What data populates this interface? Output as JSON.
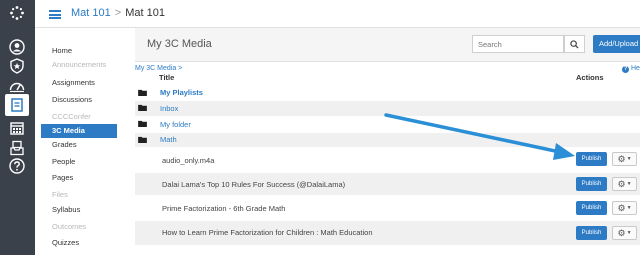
{
  "global_nav": {
    "icons": [
      "canvas-logo-icon",
      "account-icon",
      "admin-icon",
      "dashboard-icon",
      "courses-icon",
      "calendar-icon",
      "inbox-icon",
      "help-icon"
    ]
  },
  "breadcrumb": {
    "course": "Mat 101",
    "separator": ">",
    "current": "Mat 101"
  },
  "course_nav": [
    {
      "label": "Home",
      "state": "normal"
    },
    {
      "label": "Announcements",
      "state": "dim"
    },
    {
      "label": "Assignments",
      "state": "normal"
    },
    {
      "label": "Discussions",
      "state": "normal"
    },
    {
      "label": "CCCConfer",
      "state": "dim"
    },
    {
      "label": "3C Media",
      "state": "active"
    },
    {
      "label": "Grades",
      "state": "normal"
    },
    {
      "label": "People",
      "state": "normal"
    },
    {
      "label": "Pages",
      "state": "normal"
    },
    {
      "label": "Files",
      "state": "dim"
    },
    {
      "label": "Syllabus",
      "state": "normal"
    },
    {
      "label": "Outcomes",
      "state": "dim"
    },
    {
      "label": "Quizzes",
      "state": "normal"
    }
  ],
  "header": {
    "title": "My 3C Media",
    "search_placeholder": "Search",
    "add_upload_label": "Add/Upload ▾"
  },
  "path": "My 3C Media >",
  "help_label": "He",
  "table": {
    "title_header": "Title",
    "actions_header": "Actions"
  },
  "folders": [
    {
      "label": "My Playlists",
      "style": "bold"
    },
    {
      "label": "Inbox",
      "style": "link"
    },
    {
      "label": "My folder",
      "style": "link"
    },
    {
      "label": "Math",
      "style": "link"
    }
  ],
  "files": [
    {
      "title": "audio_only.m4a",
      "publish_label": "Publish"
    },
    {
      "title": "Dalai Lama's Top 10 Rules For Success (@DalaiLama)",
      "publish_label": "Publish"
    },
    {
      "title": "Prime Factorization - 6th Grade Math",
      "publish_label": "Publish"
    },
    {
      "title": "How to Learn Prime Factorization for Children : Math Education",
      "publish_label": "Publish"
    }
  ],
  "colors": {
    "nav_bg": "#3a414a",
    "accent": "#2c7bc4",
    "annotation_arrow": "#2a8fd6"
  }
}
